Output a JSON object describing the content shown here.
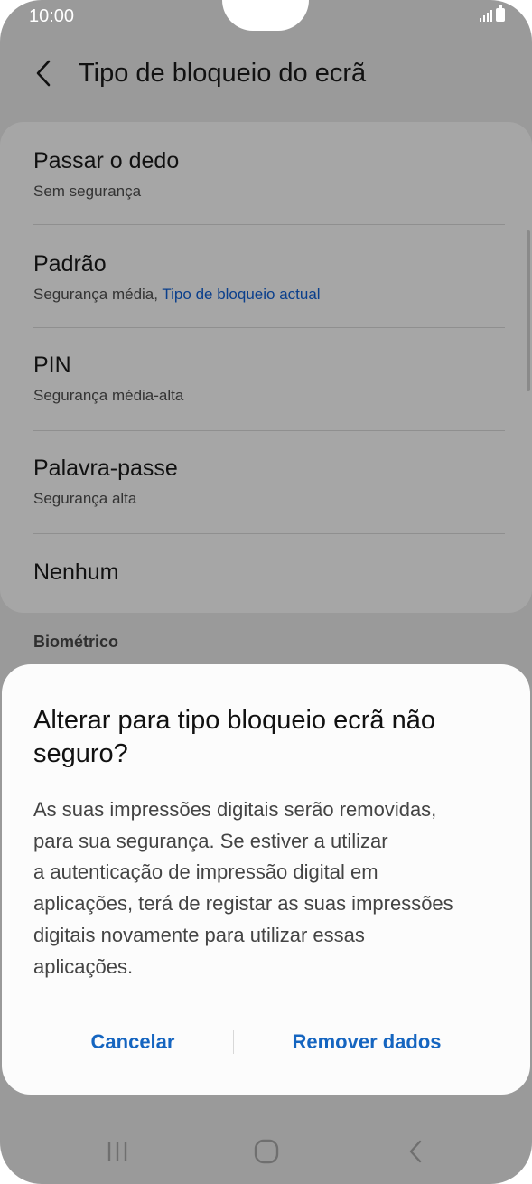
{
  "status_bar": {
    "time": "10:00"
  },
  "header": {
    "title": "Tipo de bloqueio do ecrã"
  },
  "options": [
    {
      "title": "Passar o dedo",
      "subtitle": "Sem segurança"
    },
    {
      "title": "Padrão",
      "subtitle": "Segurança média, ",
      "subtitle_accent": "Tipo de bloqueio actual"
    },
    {
      "title": "PIN",
      "subtitle": "Segurança média-alta"
    },
    {
      "title": "Palavra-passe",
      "subtitle": "Segurança alta"
    },
    {
      "title": "Nenhum"
    }
  ],
  "section_label": "Biométrico",
  "dialog": {
    "title": "Alterar para tipo bloqueio ecrã não seguro?",
    "body_lines": [
      "As suas impressões digitais serão removidas,",
      "para sua segurança. Se estiver a utilizar",
      "a autenticação de impressão digital em",
      "aplicações, terá de registar as suas impressões",
      "digitais novamente para utilizar essas",
      "aplicações."
    ],
    "cancel_label": "Cancelar",
    "remove_label": "Remover dados"
  },
  "colors": {
    "accent": "#1565c0",
    "scrim_background": "#9a9a9a",
    "dialog_background": "#fcfcfc"
  },
  "icons": {
    "back": "chevron-left-icon",
    "signal": "signal-icon",
    "battery": "battery-icon",
    "nav_recents": "recents-icon",
    "nav_home": "home-icon",
    "nav_back": "back-icon"
  }
}
